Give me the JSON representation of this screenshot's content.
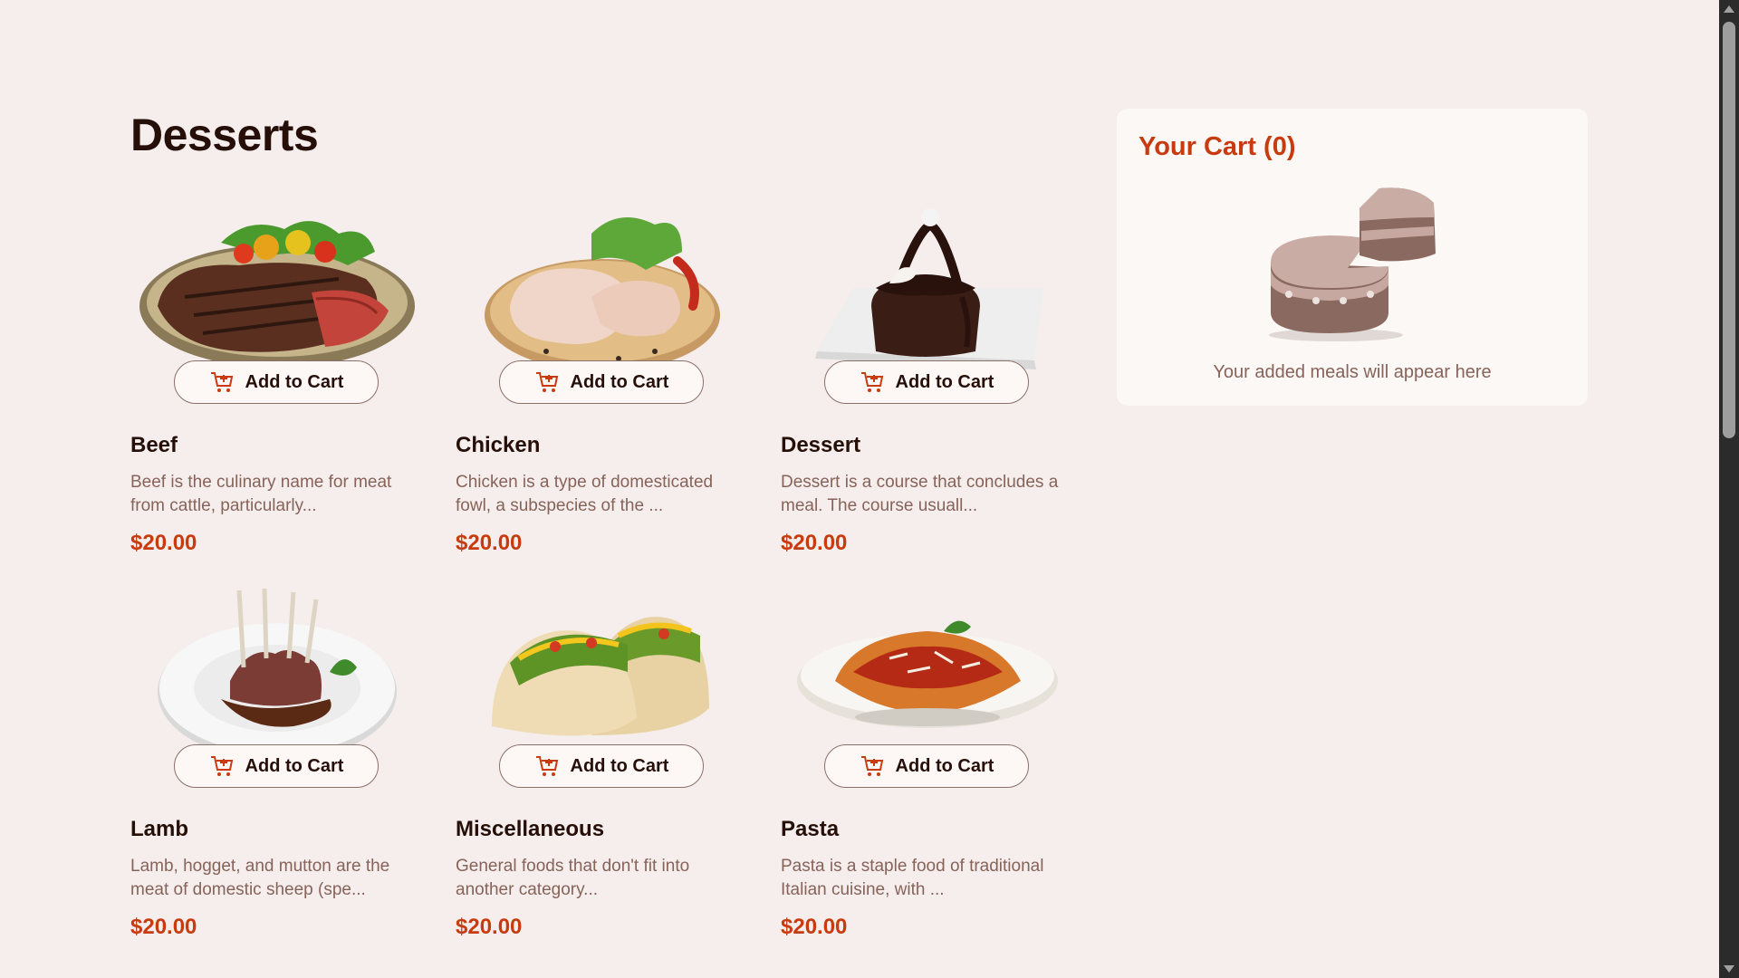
{
  "page": {
    "title": "Desserts"
  },
  "add_to_cart_label": "Add to Cart",
  "products": [
    {
      "name": "Beef",
      "description": "Beef is the culinary name for meat from cattle, particularly...",
      "price": "$20.00",
      "image": "beef-steak"
    },
    {
      "name": "Chicken",
      "description": "Chicken is a type of domesticated fowl, a subspecies of the ...",
      "price": "$20.00",
      "image": "chicken-legs"
    },
    {
      "name": "Dessert",
      "description": "Dessert is a course that concludes a meal. The course usuall...",
      "price": "$20.00",
      "image": "chocolate-cake"
    },
    {
      "name": "Lamb",
      "description": "Lamb, hogget, and mutton are the meat of domestic sheep (spe...",
      "price": "$20.00",
      "image": "lamb-chops"
    },
    {
      "name": "Miscellaneous",
      "description": "General foods that don't fit into another category...",
      "price": "$20.00",
      "image": "tacos"
    },
    {
      "name": "Pasta",
      "description": "Pasta is a staple food of traditional Italian cuisine, with ...",
      "price": "$20.00",
      "image": "penne-pasta"
    }
  ],
  "cart": {
    "title": "Your Cart (0)",
    "empty_message": "Your added meals will appear here",
    "illustration": "empty-cake-illustration"
  },
  "colors": {
    "background": "#f5eeec",
    "accent": "#c73b0f",
    "text_dark": "#260f08",
    "text_muted": "#87635a"
  }
}
